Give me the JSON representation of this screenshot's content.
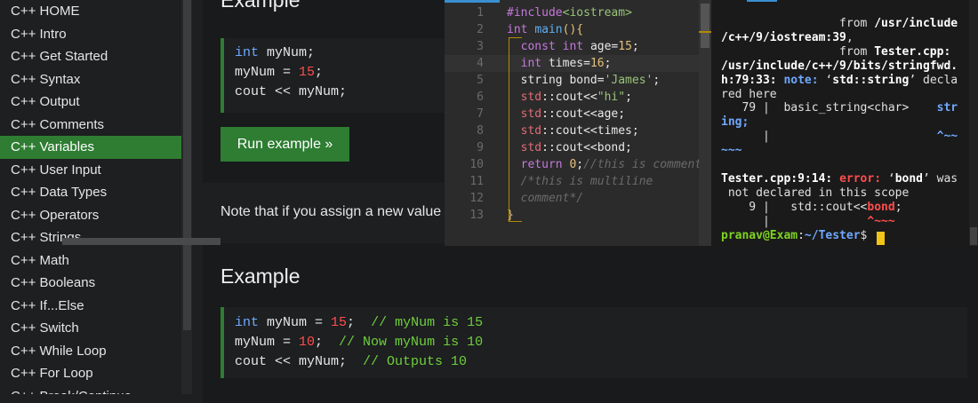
{
  "sidebar": {
    "items": [
      {
        "label": "C++ HOME"
      },
      {
        "label": "C++ Intro"
      },
      {
        "label": "C++ Get Started"
      },
      {
        "label": "C++ Syntax"
      },
      {
        "label": "C++ Output"
      },
      {
        "label": "C++ Comments"
      },
      {
        "label": "C++ Variables",
        "active": true
      },
      {
        "label": "C++ User Input"
      },
      {
        "label": "C++ Data Types"
      },
      {
        "label": "C++ Operators"
      },
      {
        "label": "C++ Strings"
      },
      {
        "label": "C++ Math"
      },
      {
        "label": "C++ Booleans"
      },
      {
        "label": "C++ If...Else"
      },
      {
        "label": "C++ Switch"
      },
      {
        "label": "C++ While Loop"
      },
      {
        "label": "C++ For Loop"
      },
      {
        "label": "C++ Break/Continue"
      }
    ]
  },
  "example1": {
    "title": "Example",
    "lines": [
      [
        {
          "t": "int",
          "c": "kw"
        },
        {
          "t": " myNum;"
        }
      ],
      [
        {
          "t": "myNum = "
        },
        {
          "t": "15",
          "c": "num"
        },
        {
          "t": ";"
        }
      ],
      [
        {
          "t": "cout << myNum;"
        }
      ]
    ],
    "run_label": "Run example »"
  },
  "note": "Note that if you assign a new value",
  "example2": {
    "title": "Example",
    "lines": [
      [
        {
          "t": "int",
          "c": "kw"
        },
        {
          "t": " myNum = "
        },
        {
          "t": "15",
          "c": "num"
        },
        {
          "t": ";  "
        },
        {
          "t": "// myNum is 15",
          "c": "cm"
        }
      ],
      [
        {
          "t": "myNum = "
        },
        {
          "t": "10",
          "c": "num"
        },
        {
          "t": ";  "
        },
        {
          "t": "// Now myNum is 10",
          "c": "cm"
        }
      ],
      [
        {
          "t": "cout << myNum;  "
        },
        {
          "t": "// Outputs 10",
          "c": "cm"
        }
      ]
    ]
  },
  "editor": {
    "lines": [
      {
        "n": "1",
        "s": [
          {
            "t": "#include",
            "c": "e-pp"
          },
          {
            "t": "<iostream>",
            "c": "e-str"
          }
        ]
      },
      {
        "n": "2",
        "s": [
          {
            "t": "int ",
            "c": "e-type"
          },
          {
            "t": "main",
            "c": "e-fn"
          },
          {
            "t": "(){",
            "c": "e-num"
          }
        ]
      },
      {
        "n": "3",
        "s": [
          {
            "t": "  "
          },
          {
            "t": "const int ",
            "c": "e-type"
          },
          {
            "t": "age="
          },
          {
            "t": "15",
            "c": "e-num"
          },
          {
            "t": ";"
          }
        ]
      },
      {
        "n": "4",
        "s": [
          {
            "t": "  "
          },
          {
            "t": "int ",
            "c": "e-type"
          },
          {
            "t": "times="
          },
          {
            "t": "16",
            "c": "e-num"
          },
          {
            "t": ";"
          }
        ]
      },
      {
        "n": "5",
        "s": [
          {
            "t": "  string bond="
          },
          {
            "t": "'James'",
            "c": "e-str"
          },
          {
            "t": ";"
          }
        ]
      },
      {
        "n": "6",
        "s": [
          {
            "t": "  "
          },
          {
            "t": "std",
            "c": "e-std"
          },
          {
            "t": "::cout<<"
          },
          {
            "t": "\"hi\"",
            "c": "e-str"
          },
          {
            "t": ";"
          }
        ]
      },
      {
        "n": "7",
        "s": [
          {
            "t": "  "
          },
          {
            "t": "std",
            "c": "e-std"
          },
          {
            "t": "::cout<<age;"
          }
        ]
      },
      {
        "n": "8",
        "s": [
          {
            "t": "  "
          },
          {
            "t": "std",
            "c": "e-std"
          },
          {
            "t": "::cout<<times;"
          }
        ]
      },
      {
        "n": "9",
        "s": [
          {
            "t": "  "
          },
          {
            "t": "std",
            "c": "e-std"
          },
          {
            "t": "::cout<<bond;"
          }
        ]
      },
      {
        "n": "10",
        "s": [
          {
            "t": "  "
          },
          {
            "t": "return ",
            "c": "e-type"
          },
          {
            "t": "0",
            "c": "e-num"
          },
          {
            "t": ";"
          },
          {
            "t": "//this is comment",
            "c": "e-cm"
          }
        ]
      },
      {
        "n": "11",
        "s": [
          {
            "t": "  "
          },
          {
            "t": "/*this is multiline",
            "c": "e-cm"
          }
        ]
      },
      {
        "n": "12",
        "s": [
          {
            "t": "  "
          },
          {
            "t": "comment*/",
            "c": "e-cm"
          }
        ]
      },
      {
        "n": "13",
        "s": [
          {
            "t": "}",
            "c": "e-num"
          }
        ]
      }
    ]
  },
  "terminal": {
    "lines": [
      [
        {
          "t": "                 from "
        },
        {
          "t": "/usr/include",
          "c": "t-b"
        }
      ],
      [
        {
          "t": "/c++/9/iostream:39",
          "c": "t-b"
        },
        {
          "t": ","
        }
      ],
      [
        {
          "t": "                 from "
        },
        {
          "t": "Tester.cpp:",
          "c": "t-b"
        }
      ],
      [
        {
          "t": "/usr/include/c++/9/bits/stringfwd.",
          "c": "t-b"
        }
      ],
      [
        {
          "t": "h:79:33: ",
          "c": "t-b"
        },
        {
          "t": "note: ",
          "c": "t-note"
        },
        {
          "t": "‘"
        },
        {
          "t": "std::string",
          "c": "t-b"
        },
        {
          "t": "’ decla"
        }
      ],
      [
        {
          "t": "red here"
        }
      ],
      [
        {
          "t": "   79 |  basic_string<char>    "
        },
        {
          "t": "str",
          "c": "t-cyan"
        }
      ],
      [
        {
          "t": "ing;",
          "c": "t-cyan"
        }
      ],
      [
        {
          "t": "      |                        "
        },
        {
          "t": "^~~",
          "c": "t-cyan"
        }
      ],
      [
        {
          "t": "~~~",
          "c": "t-cyan"
        }
      ],
      [
        {
          "t": ""
        }
      ],
      [
        {
          "t": "Tester.cpp:9:14: ",
          "c": "t-b"
        },
        {
          "t": "error: ",
          "c": "t-err"
        },
        {
          "t": "‘"
        },
        {
          "t": "bond",
          "c": "t-b"
        },
        {
          "t": "’ was"
        }
      ],
      [
        {
          "t": " not declared in this scope"
        }
      ],
      [
        {
          "t": "    9 |   std::cout<<"
        },
        {
          "t": "bond",
          "c": "t-red"
        },
        {
          "t": ";"
        }
      ],
      [
        {
          "t": "      |              "
        },
        {
          "t": "^~~~",
          "c": "t-red"
        }
      ],
      [
        {
          "t": "pranav@Exam",
          "c": "t-green"
        },
        {
          "t": ":"
        },
        {
          "t": "~/Tester",
          "c": "t-path"
        },
        {
          "t": "$ "
        }
      ]
    ]
  }
}
